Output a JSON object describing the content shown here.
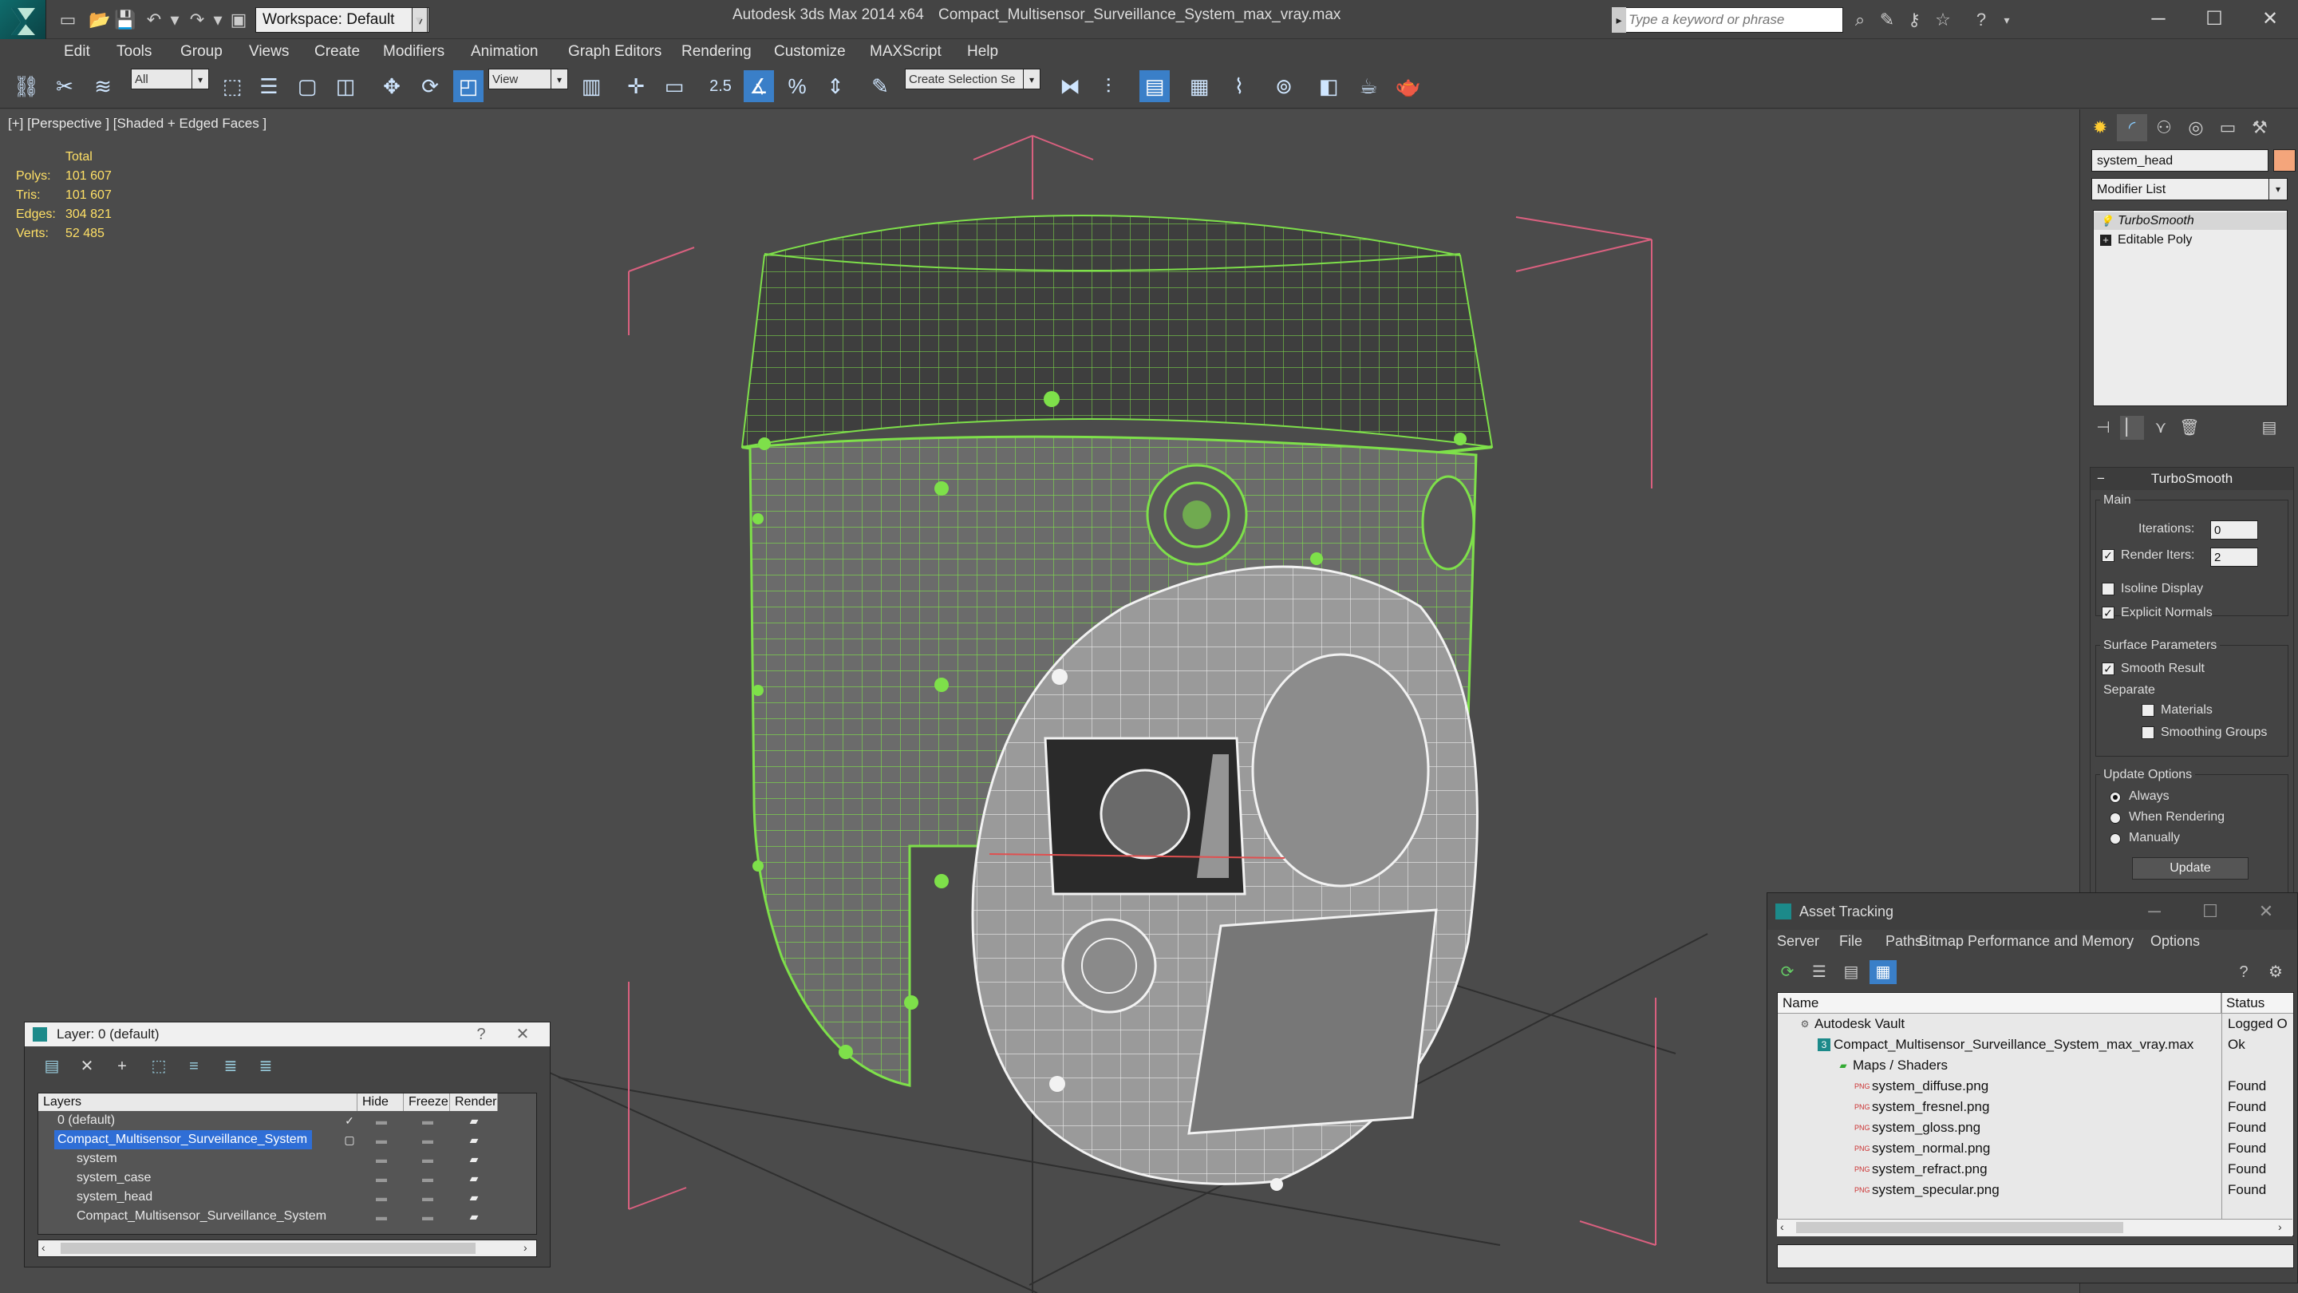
{
  "app": {
    "title": "Autodesk 3ds Max 2014 x64",
    "file": "Compact_Multisensor_Surveillance_System_max_vray.max",
    "workspace": "Workspace: Default",
    "search_placeholder": "Type a keyword or phrase"
  },
  "menu": [
    "Edit",
    "Tools",
    "Group",
    "Views",
    "Create",
    "Modifiers",
    "Animation",
    "Graph Editors",
    "Rendering",
    "Customize",
    "MAXScript",
    "Help"
  ],
  "toolbar": {
    "filter": "All",
    "ref_coord": "View",
    "selection_set": "Create Selection Se",
    "snap_angle": "2.5"
  },
  "viewport": {
    "label": "[+] [Perspective ] [Shaded + Edged Faces ]",
    "stats_header": "Total",
    "stats": [
      {
        "label": "Polys:",
        "value": "101 607"
      },
      {
        "label": "Tris:",
        "value": "101 607"
      },
      {
        "label": "Edges:",
        "value": "304 821"
      },
      {
        "label": "Verts:",
        "value": "52 485"
      }
    ]
  },
  "command_panel": {
    "object_name": "system_head",
    "object_color": "#f4a57b",
    "modifier_list": "Modifier List",
    "stack": [
      "TurboSmooth",
      "Editable Poly"
    ],
    "rollout_title": "TurboSmooth",
    "main_label": "Main",
    "iterations_label": "Iterations:",
    "iterations_value": "0",
    "render_iters_label": "Render Iters:",
    "render_iters_value": "2",
    "isoline_label": "Isoline Display",
    "explicit_normals_label": "Explicit Normals",
    "surface_params_label": "Surface Parameters",
    "smooth_result_label": "Smooth Result",
    "separate_label": "Separate",
    "materials_label": "Materials",
    "smoothing_groups_label": "Smoothing Groups",
    "update_options_label": "Update Options",
    "always_label": "Always",
    "when_rendering_label": "When Rendering",
    "manually_label": "Manually",
    "update_button": "Update"
  },
  "layer_window": {
    "title": "Layer: 0 (default)",
    "columns": [
      "Layers",
      "Hide",
      "Freeze",
      "Render"
    ],
    "rows": [
      "0 (default)",
      "Compact_Multisensor_Surveillance_System",
      "system",
      "system_case",
      "system_head",
      "Compact_Multisensor_Surveillance_System"
    ]
  },
  "asset_window": {
    "title": "Asset Tracking",
    "menus": [
      "Server",
      "File",
      "Paths",
      "Bitmap Performance and Memory",
      "Options"
    ],
    "columns": [
      "Name",
      "Status"
    ],
    "rows": [
      {
        "name": "Autodesk Vault",
        "status": "Logged O"
      },
      {
        "name": "Compact_Multisensor_Surveillance_System_max_vray.max",
        "status": "Ok"
      },
      {
        "name": "Maps / Shaders",
        "status": ""
      },
      {
        "name": "system_diffuse.png",
        "status": "Found"
      },
      {
        "name": "system_fresnel.png",
        "status": "Found"
      },
      {
        "name": "system_gloss.png",
        "status": "Found"
      },
      {
        "name": "system_normal.png",
        "status": "Found"
      },
      {
        "name": "system_refract.png",
        "status": "Found"
      },
      {
        "name": "system_specular.png",
        "status": "Found"
      }
    ]
  },
  "colors": {
    "wire_green": "#7ee04a",
    "wire_white": "#f2f2f2",
    "bbox_pink": "#d9607f",
    "stats_yellow": "#ffe066",
    "selection_blue": "#2f6ed6"
  }
}
